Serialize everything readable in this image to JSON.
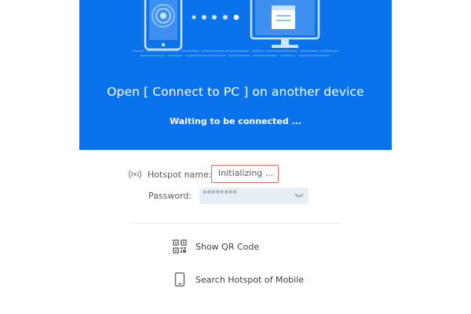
{
  "banner": {
    "title": "Open [ Connect to PC ] on another device",
    "status": "Waiting to be connected ..."
  },
  "form": {
    "hotspot_label": "Hotspot name:",
    "hotspot_value": "Initializing ...",
    "password_label": "Password:",
    "password_value": "********"
  },
  "actions": [
    {
      "label": "Show QR Code",
      "icon": "qr-code-icon"
    },
    {
      "label": "Search Hotspot of Mobile",
      "icon": "mobile-phone-icon"
    }
  ],
  "colors": {
    "banner_bg": "#0a73ec",
    "field_highlight_border": "#e26a6a",
    "password_bg": "#e8eef6",
    "label_text": "#555a63"
  }
}
